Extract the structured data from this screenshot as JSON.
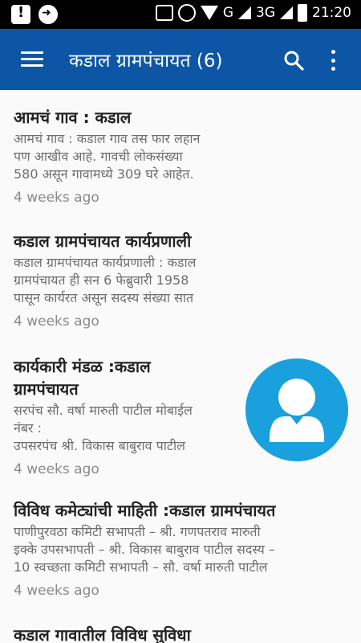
{
  "statusbar": {
    "network": "G",
    "network2": "3G",
    "time": "21:20"
  },
  "appbar": {
    "title": "कडाल ग्रामपंचायत (6)"
  },
  "items": [
    {
      "title": "आमचं गाव : कडाल",
      "desc": [
        "आमचं गाव : कडाल गाव तस फार लहान",
        "पण आखीव आहे. गावची लोकसंख्या",
        "580 असून गावामध्ये 309 घरे आहेत."
      ],
      "time": "4 weeks ago"
    },
    {
      "title": "कडाल ग्रामपंचायत कार्यप्रणाली",
      "desc": [
        "कडाल ग्रामपंचायत कार्यप्रणाली : कडाल",
        "ग्रामपंचायत ही सन 6 फेब्रुवारी 1958",
        "पासून कार्यरत असून सदस्य संख्या सात"
      ],
      "time": "4 weeks ago"
    },
    {
      "title_lines": [
        "कार्यकारी मंडळ :कडाल",
        "ग्रामपंचायत"
      ],
      "desc": [
        "सरपंच सौ. वर्षा मारुती पाटील  मोबाईल",
        "नंबर :",
        "उपसरपंच श्री. विकास बाबुराव पाटील"
      ],
      "time": "4 weeks ago",
      "thumbnail": "avatar-icon"
    },
    {
      "title": "विविध कमेट्यांची माहिती :कडाल ग्रामपंचायत",
      "desc": [
        "  पाणीपुरवठा कमिटी   सभापती –  श्री. गणपतराव मारुती",
        "इक्के उपसभापती – श्री. विकास बाबुराव पाटील सदस्य –",
        "10 स्वच्छता कमिटी   सभापती –  सौ. वर्षा मारुती पाटील"
      ],
      "time": "4 weeks ago"
    },
    {
      "title": "कडाल गावातील विविध सुविधा"
    }
  ],
  "colors": {
    "appbar": "#0d56a6",
    "avatar_bg": "#1aa0dc"
  }
}
